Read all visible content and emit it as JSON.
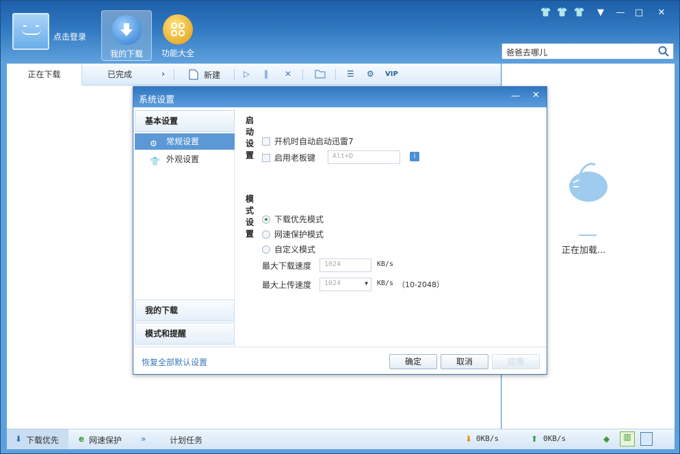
{
  "topbar": {
    "login_label": "点击登录",
    "nav": [
      {
        "label": "我的下载"
      },
      {
        "label": "功能大全"
      }
    ],
    "search_value": "爸爸去哪儿"
  },
  "tabs": {
    "downloading": "正在下载",
    "completed": "已完成",
    "new_label": "新建"
  },
  "right_pane": {
    "loading": "正在加载..."
  },
  "dialog": {
    "title": "系统设置",
    "side": {
      "basic": "基本设置",
      "general": "常规设置",
      "appearance": "外观设置",
      "my_download": "我的下载",
      "mode_alert": "模式和提醒"
    },
    "startup": {
      "heading": "启动设置",
      "auto_start": "开机时自动启动迅雷7",
      "boss_key": "启用老板键",
      "boss_key_value": "Alt+D"
    },
    "mode": {
      "heading": "模式设置",
      "options": [
        "下载优先模式",
        "网速保护模式",
        "自定义模式"
      ],
      "max_down_label": "最大下载速度",
      "max_down_value": "1024",
      "max_up_label": "最大上传速度",
      "max_up_value": "1024",
      "unit": "KB/s",
      "range": "（10-2048）"
    },
    "restore": "恢复全部默认设置",
    "ok": "确定",
    "cancel": "取消",
    "apply": "应用"
  },
  "status": {
    "download_first": "下载优先",
    "net_protect": "网速保护",
    "scheduled": "计划任务",
    "down_speed": "0KB/s",
    "up_speed": "0KB/s"
  }
}
